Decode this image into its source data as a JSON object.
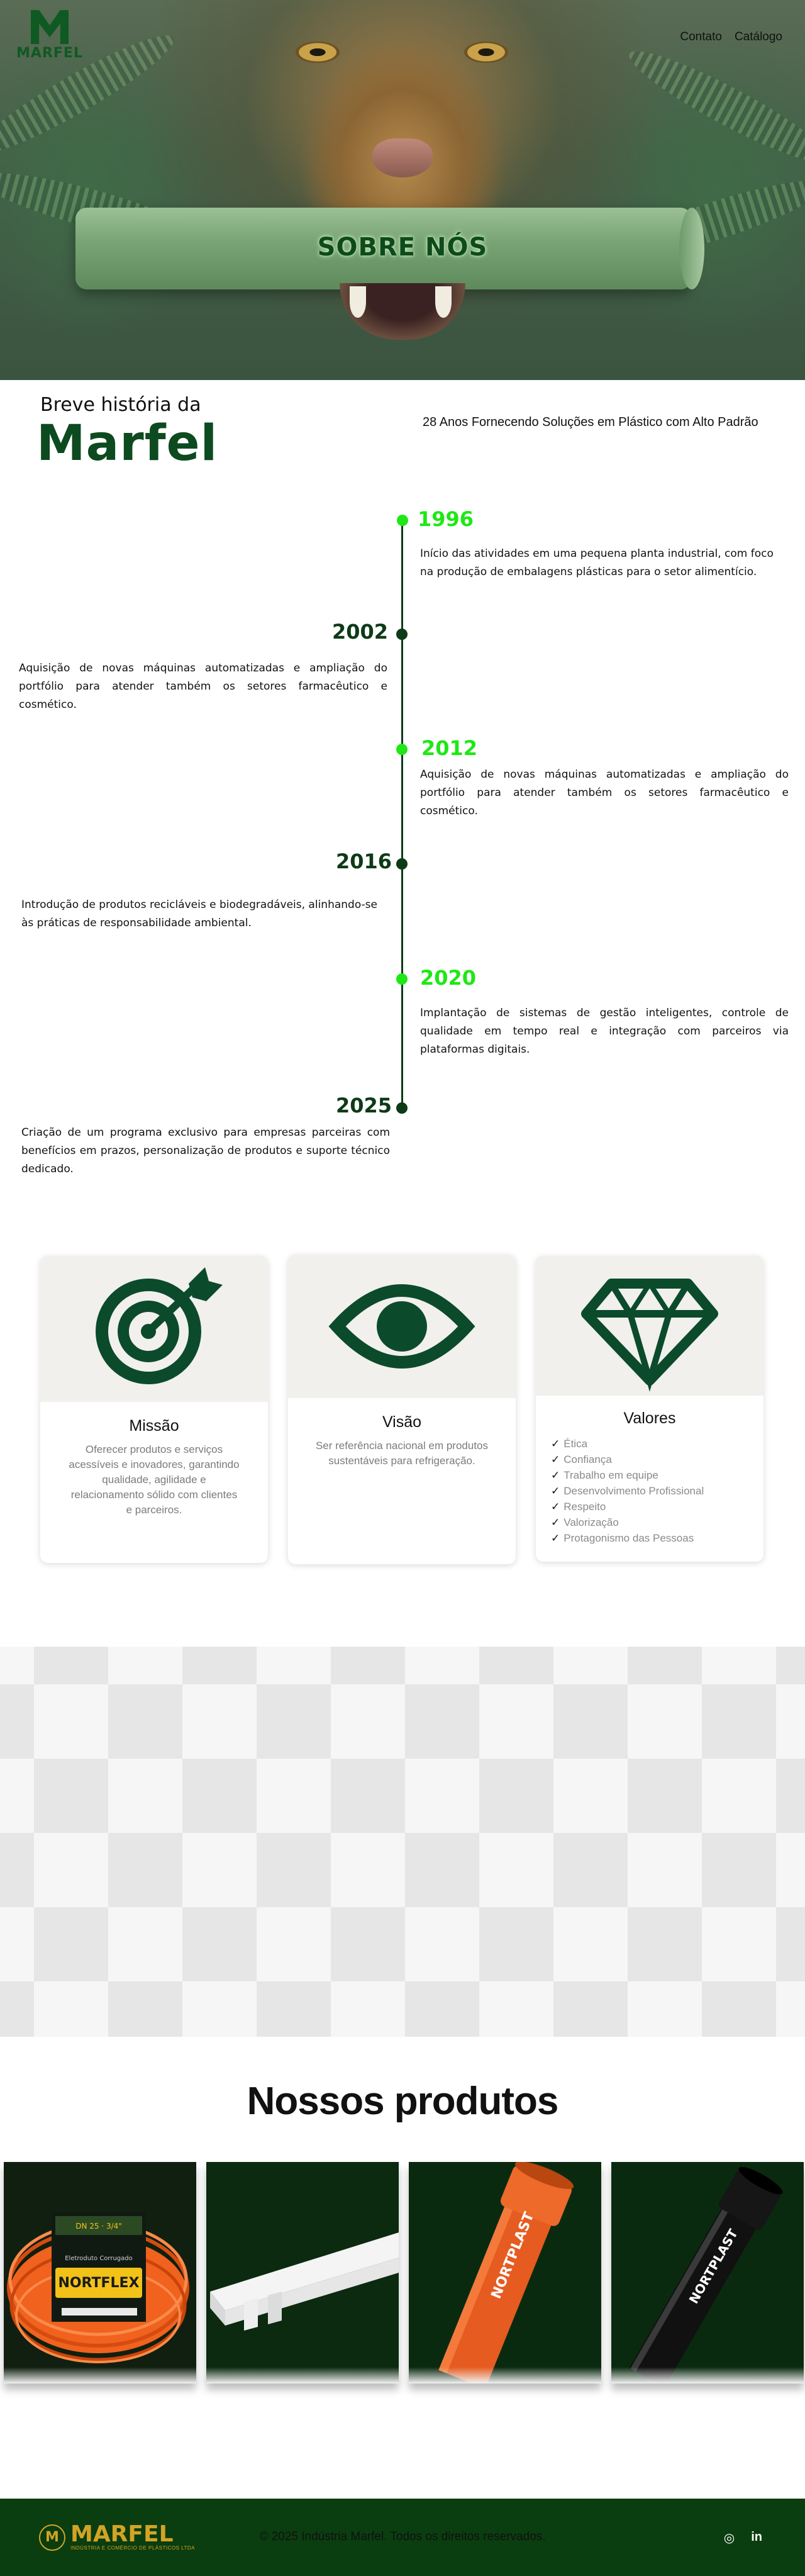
{
  "header": {
    "logo_text": "MARFEL",
    "nav": [
      {
        "label": "Contato"
      },
      {
        "label": "Catálogo"
      }
    ]
  },
  "hero": {
    "title": "SOBRE NÓS"
  },
  "history": {
    "heading": "Breve história da",
    "brand": "Marfel",
    "tagline": "28 Anos Fornecendo Soluções em Plástico com Alto Padrão",
    "timeline": [
      {
        "year": "1996",
        "text": "Início das atividades em uma pequena planta industrial, com foco na produção de embalagens plásticas para o setor alimentício."
      },
      {
        "year": "2002",
        "text": "Aquisição de novas máquinas automatizadas e ampliação do portfólio para atender também os setores farmacêutico e cosmético."
      },
      {
        "year": "2012",
        "text": "Aquisição de novas máquinas automatizadas e ampliação do portfólio para atender também os setores farmacêutico e cosmético."
      },
      {
        "year": "2016",
        "text": "Introdução de produtos recicláveis e biodegradáveis, alinhando-se às práticas de responsabilidade ambiental."
      },
      {
        "year": "2020",
        "text": "Implantação de sistemas de gestão inteligentes, controle de qualidade em tempo real e integração com parceiros via plataformas digitais."
      },
      {
        "year": "2025",
        "text": "Criação de um programa exclusivo para empresas parceiras com benefícios em prazos, personalização de produtos e suporte técnico dedicado."
      }
    ],
    "colors": {
      "accent": "#1ee815",
      "dark": "#0d3a17"
    }
  },
  "values": {
    "mission": {
      "icon": "target-icon",
      "title": "Missão",
      "text": "Oferecer produtos e serviços acessíveis e inovadores, garantindo qualidade, agilidade e relacionamento sólido com clientes e parceiros."
    },
    "vision": {
      "icon": "eye-icon",
      "title": "Visão",
      "text": "Ser referência nacional em produtos sustentáveis para refrigeração."
    },
    "values": {
      "icon": "diamond-icon",
      "title": "Valores",
      "items": [
        "Ética",
        "Confiança",
        "Trabalho em equipe",
        "Desenvolvimento Profissional",
        "Respeito",
        "Valorização",
        "Protagonismo das Pessoas"
      ]
    }
  },
  "products": {
    "title": "Nossos produtos",
    "items": [
      {
        "brand": "NORTFLEX",
        "top": "DN 25 · 3/4\"",
        "spec": "Eletroduto Corrugado"
      },
      {
        "brand": ""
      },
      {
        "brand": "NORTPLAST"
      },
      {
        "brand": "NORTPLAST"
      }
    ]
  },
  "footer": {
    "logo_text": "MARFEL",
    "logo_tag": "INDÚSTRIA E COMÉRCIO DE PLÁSTICOS LTDA",
    "copyright": "© 2025 Indústria Marfel. Todos os direitos reservados.",
    "social": [
      {
        "icon": "instagram-icon",
        "glyph": "◎"
      },
      {
        "icon": "linkedin-icon",
        "glyph": "in"
      }
    ]
  }
}
